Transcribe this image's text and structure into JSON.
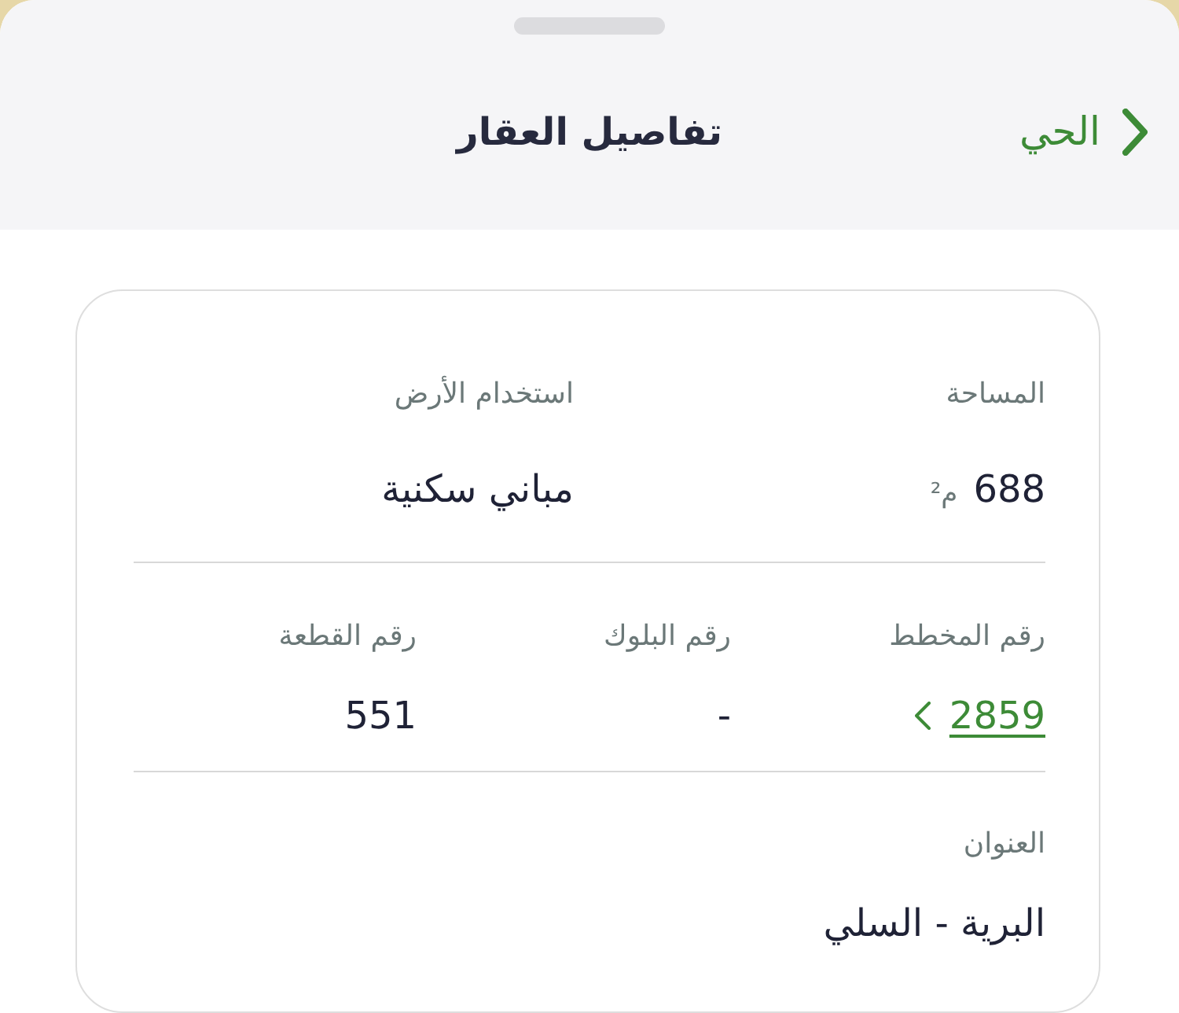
{
  "header": {
    "back_label": "الحي",
    "title": "تفاصيل العقار"
  },
  "details": {
    "rows": [
      {
        "fields": [
          {
            "kind": "text",
            "label": "المساحة",
            "value": "688",
            "unit": "م²"
          },
          {
            "kind": "text",
            "label": "استخدام الأرض",
            "value": "مباني سكنية"
          }
        ]
      },
      {
        "fields": [
          {
            "kind": "link",
            "label": "رقم المخطط",
            "value": "2859"
          },
          {
            "kind": "text",
            "label": "رقم البلوك",
            "value": "-"
          },
          {
            "kind": "text",
            "label": "رقم القطعة",
            "value": "551"
          }
        ]
      },
      {
        "fields": [
          {
            "kind": "text",
            "label": "العنوان",
            "value": "البرية - السلي"
          }
        ]
      }
    ]
  }
}
